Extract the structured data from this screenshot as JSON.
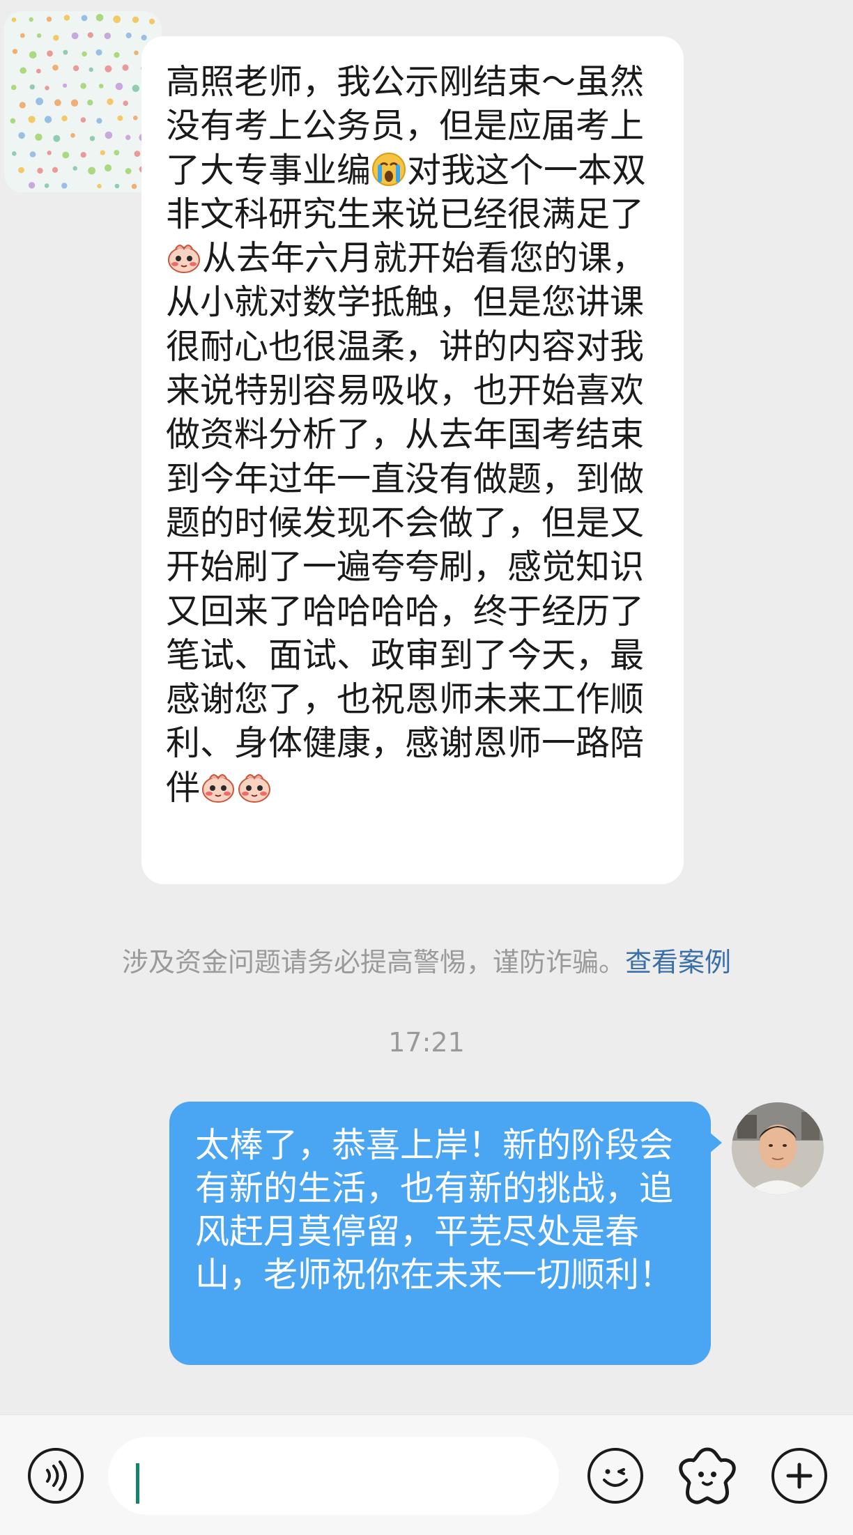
{
  "messages": {
    "incoming": {
      "parts": [
        "高照老师，我公示刚结束～虽然没有考上公务员，但是应届考上了大专事业编",
        "对我这个一本双非文科研究生来说已经很满足了",
        "从去年六月就开始看您的课，从小就对数学抵触，但是您讲课很耐心也很温柔，讲的内容对我来说特别容易吸收，也开始喜欢做资料分析了，从去年国考结束到今年过年一直没有做题，到做题的时候发现不会做了，但是又开始刷了一遍夸夸刷，感觉知识又回来了哈哈哈哈，终于经历了笔试、面试、政审到了今天，最感谢您了，也祝恩师未来工作顺利、身体健康，感谢恩师一路陪伴"
      ],
      "emoji_icons": [
        "crying-emoji-icon",
        "blushing-sticker-emoji-icon",
        "blushing-sticker-emoji-icon",
        "blushing-sticker-emoji-icon"
      ]
    },
    "outgoing": {
      "text": "太棒了，恭喜上岸！新的阶段会有新的生活，也有新的挑战，追风赶月莫停留，平芜尽处是春山，老师祝你在未来一切顺利！"
    }
  },
  "security_tip": {
    "text": "涉及资金问题请务必提高警惕，谨防诈骗。",
    "link": "查看案例"
  },
  "timestamp": "17:21",
  "input_bar": {
    "value": "",
    "icons": [
      "voice-icon",
      "emoji-face-icon",
      "sticker-icon",
      "plus-icon"
    ]
  },
  "colors": {
    "background": "#ededed",
    "incoming_bubble": "#ffffff",
    "outgoing_bubble": "#4aa6f2",
    "link": "#3b6fa8",
    "caret": "#13856b"
  }
}
